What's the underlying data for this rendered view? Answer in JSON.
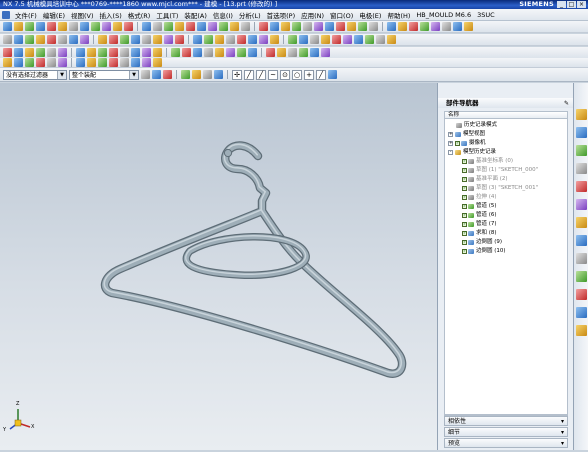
{
  "window": {
    "title": "NX 7.5 机械模具培训中心 ***0769-****1860 www.mjcl.com*** - 建模 - [13.prt (修改的) ]",
    "brand": "SIEMENS",
    "buttons": [
      "_",
      "□",
      "×"
    ]
  },
  "menu": {
    "items": [
      "文件(F)",
      "编辑(E)",
      "视图(V)",
      "插入(S)",
      "格式(R)",
      "工具(T)",
      "装配(A)",
      "信息(I)",
      "分析(L)",
      "首选项(P)",
      "应用(N)",
      "窗口(O)",
      "电极(E)",
      "帮助(H)",
      "HB_MOULD M6.6",
      "3SUC"
    ]
  },
  "selection_bar": {
    "filter_value": "没有选择过滤器",
    "scope_value": "整个装配"
  },
  "navigator": {
    "title": "部件导航器",
    "column_name": "名称",
    "nodes": [
      {
        "label": "历史记录模式",
        "expand": "",
        "check": false,
        "icon": "k",
        "dim": false,
        "num": "",
        "indent": 8
      },
      {
        "label": "模型视图",
        "expand": "+",
        "check": false,
        "icon": "b",
        "dim": false,
        "num": "",
        "indent": 0
      },
      {
        "label": "摄像机",
        "expand": "+",
        "check": true,
        "icon": "b",
        "dim": false,
        "num": "",
        "indent": 0
      },
      {
        "label": "模型历史记录",
        "expand": "-",
        "check": false,
        "icon": "y",
        "dim": false,
        "num": "",
        "indent": 0
      },
      {
        "label": "基准坐标系 (0)",
        "expand": "",
        "check": true,
        "icon": "k",
        "dim": true,
        "num": "",
        "indent": 14
      },
      {
        "label": "草图 (1) \"SKETCH_000\"",
        "expand": "",
        "check": true,
        "icon": "k",
        "dim": true,
        "num": "",
        "indent": 14
      },
      {
        "label": "基准平面 (2)",
        "expand": "",
        "check": true,
        "icon": "k",
        "dim": true,
        "num": "",
        "indent": 14
      },
      {
        "label": "草图 (3) \"SKETCH_001\"",
        "expand": "",
        "check": true,
        "icon": "k",
        "dim": true,
        "num": "",
        "indent": 14
      },
      {
        "label": "拉伸 (4)",
        "expand": "",
        "check": true,
        "icon": "k",
        "dim": true,
        "num": "",
        "indent": 14
      },
      {
        "label": "管道 (5)",
        "expand": "",
        "check": true,
        "icon": "g",
        "dim": false,
        "num": "",
        "indent": 14
      },
      {
        "label": "管道 (6)",
        "expand": "",
        "check": true,
        "icon": "g",
        "dim": false,
        "num": "",
        "indent": 14
      },
      {
        "label": "管道 (7)",
        "expand": "",
        "check": true,
        "icon": "g",
        "dim": false,
        "num": "",
        "indent": 14
      },
      {
        "label": "求和 (8)",
        "expand": "",
        "check": true,
        "icon": "b",
        "dim": false,
        "num": "",
        "indent": 14
      },
      {
        "label": "边倒圆 (9)",
        "expand": "",
        "check": true,
        "icon": "b",
        "dim": false,
        "num": "",
        "indent": 14
      },
      {
        "label": "边倒圆 (10)",
        "expand": "",
        "check": true,
        "icon": "b",
        "dim": false,
        "num": "",
        "indent": 14
      }
    ],
    "drawers": [
      "相依性",
      "细节",
      "预览"
    ]
  },
  "triad": {
    "x": "X",
    "y": "Y",
    "z": "Z"
  },
  "colors": {
    "accent": "#2b5fc8",
    "part": "#8e9ea8"
  }
}
